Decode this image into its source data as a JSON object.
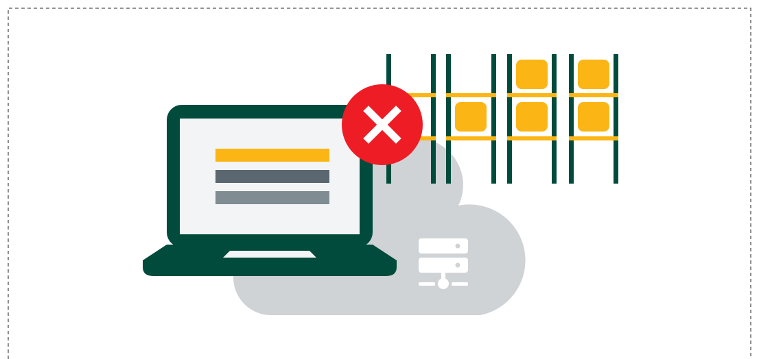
{
  "colors": {
    "frame_border": "#555555",
    "laptop_body": "#004b3b",
    "laptop_screen": "#f3f4f5",
    "bar_primary": "#fbb616",
    "bar_dark": "#5a6770",
    "bar_light": "#7f8d93",
    "cloud": "#cfd3d6",
    "server_icon": "#ffffff",
    "error_badge": "#ee1c25",
    "error_mark": "#ffffff",
    "rack_post": "#004b3b",
    "rack_shelf": "#fbb616",
    "rack_box": "#fbb616"
  },
  "icons": {
    "laptop": "laptop-icon",
    "cloud": "cloud-icon",
    "server": "server-stack-icon",
    "error": "close-icon",
    "warehouse": "warehouse-rack-icon"
  }
}
